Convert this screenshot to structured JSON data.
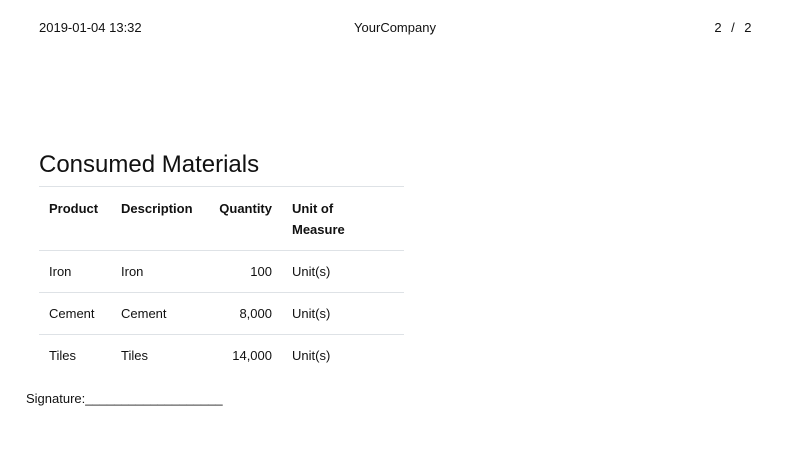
{
  "header": {
    "datetime": "2019-01-04 13:32",
    "company": "YourCompany",
    "page_current": "2",
    "page_sep": "/",
    "page_total": "2"
  },
  "section": {
    "title": "Consumed Materials"
  },
  "table": {
    "columns": {
      "product": "Product",
      "description": "Description",
      "quantity": "Quantity",
      "uom_line1": "Unit of",
      "uom_line2": "Measure"
    },
    "rows": [
      {
        "product": "Iron",
        "description": "Iron",
        "quantity": "100",
        "uom": "Unit(s)"
      },
      {
        "product": "Cement",
        "description": "Cement",
        "quantity": "8,000",
        "uom": "Unit(s)"
      },
      {
        "product": "Tiles",
        "description": "Tiles",
        "quantity": "14,000",
        "uom": "Unit(s)"
      }
    ]
  },
  "signature": {
    "label": "Signature:___________________"
  }
}
